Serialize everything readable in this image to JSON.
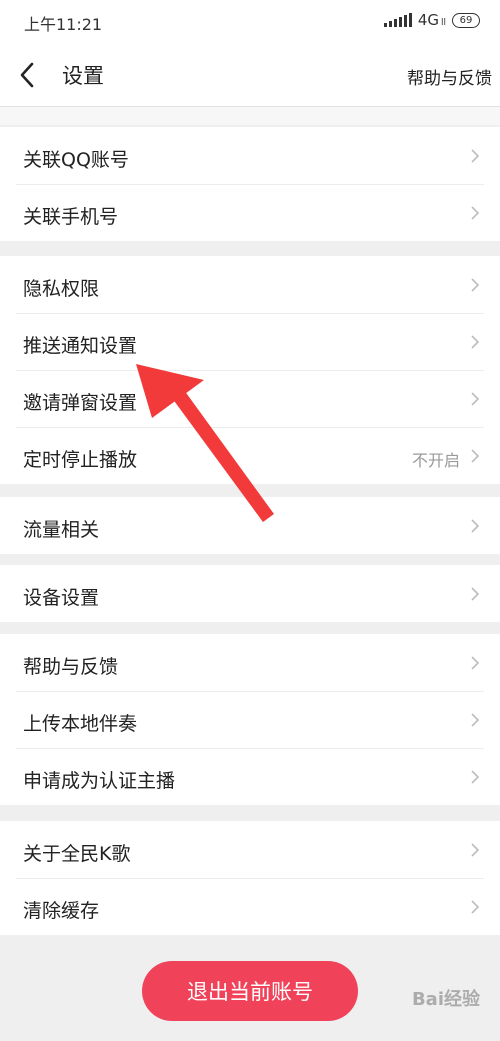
{
  "status_bar": {
    "time": "上午11:21",
    "network": "4G",
    "network_sub": "ll",
    "battery": "69"
  },
  "navbar": {
    "title": "设置",
    "help": "帮助与反馈"
  },
  "groups": [
    {
      "items": [
        {
          "label": "关联QQ账号"
        },
        {
          "label": "关联手机号"
        }
      ]
    },
    {
      "items": [
        {
          "label": "隐私权限"
        },
        {
          "label": "推送通知设置"
        },
        {
          "label": "邀请弹窗设置"
        },
        {
          "label": "定时停止播放",
          "value": "不开启"
        }
      ]
    },
    {
      "items": [
        {
          "label": "流量相关"
        }
      ]
    },
    {
      "items": [
        {
          "label": "设备设置"
        }
      ]
    },
    {
      "items": [
        {
          "label": "帮助与反馈"
        },
        {
          "label": "上传本地伴奏"
        },
        {
          "label": "申请成为认证主播"
        }
      ]
    },
    {
      "items": [
        {
          "label": "关于全民K歌"
        },
        {
          "label": "清除缓存"
        }
      ]
    }
  ],
  "logout": {
    "label": "退出当前账号"
  },
  "watermark": {
    "text": "Bai经验"
  },
  "colors": {
    "accent": "#f0435a",
    "arrow": "#f23a3a",
    "background": "#efefef"
  },
  "icons": {
    "back": "chevron-left-icon",
    "row": "chevron-right-icon"
  }
}
